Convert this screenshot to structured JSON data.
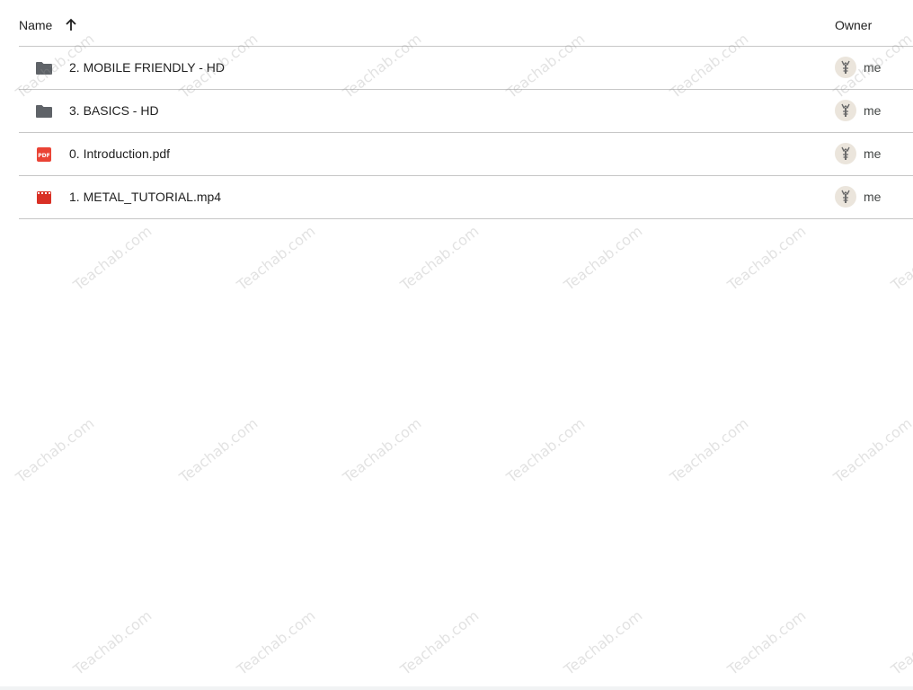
{
  "header": {
    "name_label": "Name",
    "owner_label": "Owner"
  },
  "files": [
    {
      "name": "2. MOBILE FRIENDLY - HD",
      "type": "folder",
      "icon": "folder-icon",
      "owner": "me"
    },
    {
      "name": "3. BASICS - HD",
      "type": "folder",
      "icon": "folder-icon",
      "owner": "me"
    },
    {
      "name": "0. Introduction.pdf",
      "type": "pdf",
      "icon": "pdf-icon",
      "owner": "me"
    },
    {
      "name": "1. METAL_TUTORIAL.mp4",
      "type": "video",
      "icon": "video-icon",
      "owner": "me"
    }
  ],
  "watermark": {
    "text": "Teachab.com"
  },
  "colors": {
    "folder": "#5f6368",
    "pdf": "#ea4335",
    "video": "#d93025",
    "divider": "#c7c7c7"
  }
}
